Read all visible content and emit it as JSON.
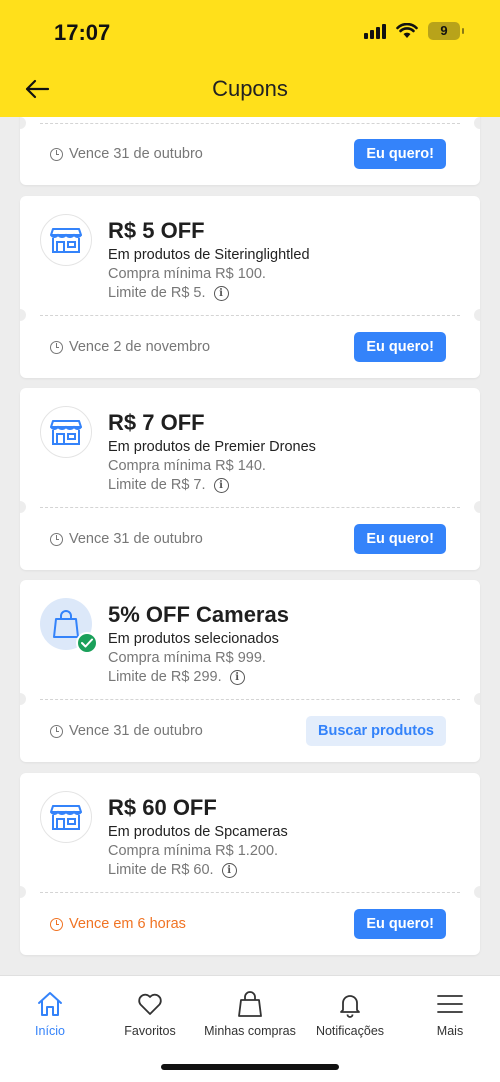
{
  "status": {
    "time": "17:07",
    "battery": "9"
  },
  "header": {
    "title": "Cupons"
  },
  "colors": {
    "brand_yellow": "#ffe01b",
    "accent_blue": "#3483fa",
    "urgent_orange": "#f07323",
    "success_green": "#1aa05a"
  },
  "coupons": [
    {
      "expires": "Vence 31 de outubro",
      "action": "Eu quero!"
    },
    {
      "icon": "store-icon",
      "title": "R$ 5 OFF",
      "subtitle": "Em produtos de Siteringlightled",
      "min_purchase": "Compra mínima R$ 100.",
      "limit": "Limite de R$ 5.",
      "expires": "Vence 2 de novembro",
      "action": "Eu quero!"
    },
    {
      "icon": "store-icon",
      "title": "R$ 7 OFF",
      "subtitle": "Em produtos de Premier Drones",
      "min_purchase": "Compra mínima R$ 140.",
      "limit": "Limite de R$ 7.",
      "expires": "Vence 31 de outubro",
      "action": "Eu quero!"
    },
    {
      "icon": "shopping-bag-icon",
      "title": "5% OFF Cameras",
      "subtitle": "Em produtos selecionados",
      "min_purchase": "Compra mínima R$ 999.",
      "limit": "Limite de R$ 299.",
      "expires": "Vence 31 de outubro",
      "action": "Buscar produtos"
    },
    {
      "icon": "store-icon",
      "title": "R$ 60 OFF",
      "subtitle": "Em produtos de Spcameras",
      "min_purchase": "Compra mínima R$ 1.200.",
      "limit": "Limite de R$ 60.",
      "expires": "Vence em 6 horas",
      "action": "Eu quero!"
    }
  ],
  "nav": [
    {
      "label": "Início",
      "icon": "home-icon",
      "active": true
    },
    {
      "label": "Favoritos",
      "icon": "heart-icon"
    },
    {
      "label": "Minhas compras",
      "icon": "bag-icon"
    },
    {
      "label": "Notificações",
      "icon": "bell-icon"
    },
    {
      "label": "Mais",
      "icon": "menu-icon"
    }
  ]
}
